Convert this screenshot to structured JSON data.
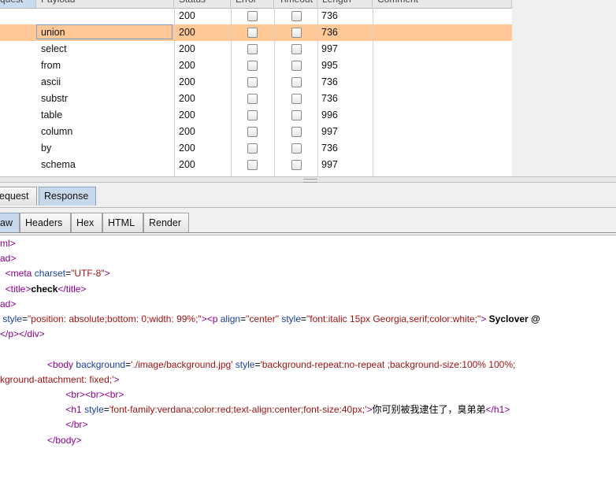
{
  "table": {
    "headers": [
      {
        "id": "request",
        "label": "quest"
      },
      {
        "id": "payload",
        "label": "Payload"
      },
      {
        "id": "status",
        "label": "Status"
      },
      {
        "id": "error",
        "label": "Error"
      },
      {
        "id": "timeout",
        "label": "Timeout"
      },
      {
        "id": "length",
        "label": "Length"
      },
      {
        "id": "comment",
        "label": "Comment"
      }
    ],
    "rows": [
      {
        "payload": "",
        "status": "200",
        "error": false,
        "timeout": false,
        "length": "736",
        "selected": false
      },
      {
        "payload": "union",
        "status": "200",
        "error": false,
        "timeout": false,
        "length": "736",
        "selected": true
      },
      {
        "payload": "select",
        "status": "200",
        "error": false,
        "timeout": false,
        "length": "997",
        "selected": false
      },
      {
        "payload": "from",
        "status": "200",
        "error": false,
        "timeout": false,
        "length": "995",
        "selected": false
      },
      {
        "payload": "ascii",
        "status": "200",
        "error": false,
        "timeout": false,
        "length": "736",
        "selected": false
      },
      {
        "payload": "substr",
        "status": "200",
        "error": false,
        "timeout": false,
        "length": "736",
        "selected": false
      },
      {
        "payload": "table",
        "status": "200",
        "error": false,
        "timeout": false,
        "length": "996",
        "selected": false
      },
      {
        "payload": "column",
        "status": "200",
        "error": false,
        "timeout": false,
        "length": "997",
        "selected": false
      },
      {
        "payload": "by",
        "status": "200",
        "error": false,
        "timeout": false,
        "length": "736",
        "selected": false
      },
      {
        "payload": "schema",
        "status": "200",
        "error": false,
        "timeout": false,
        "length": "997",
        "selected": false
      }
    ]
  },
  "tabs": {
    "main": [
      {
        "label": "equest",
        "active": false
      },
      {
        "label": "Response",
        "active": true
      }
    ],
    "sub": [
      {
        "label": "aw",
        "active": true
      },
      {
        "label": "Headers",
        "active": false
      },
      {
        "label": "Hex",
        "active": false
      },
      {
        "label": "HTML",
        "active": false
      },
      {
        "label": "Render",
        "active": false
      }
    ]
  },
  "code": {
    "lines": [
      [
        {
          "t": "tag",
          "v": "ml>"
        }
      ],
      [
        {
          "t": "tag",
          "v": "ad>"
        }
      ],
      [
        {
          "t": "txt",
          "v": "  "
        },
        {
          "t": "tag",
          "v": "<meta "
        },
        {
          "t": "attr",
          "v": "charset"
        },
        {
          "t": "txt",
          "v": "="
        },
        {
          "t": "val",
          "v": "\"UTF-8\""
        },
        {
          "t": "tag",
          "v": ">"
        }
      ],
      [
        {
          "t": "txt",
          "v": "  "
        },
        {
          "t": "tag",
          "v": "<title>"
        },
        {
          "t": "bold",
          "v": "check"
        },
        {
          "t": "tag",
          "v": "</title>"
        }
      ],
      [
        {
          "t": "tag",
          "v": "ad>"
        }
      ],
      [
        {
          "t": "txt",
          "v": " "
        },
        {
          "t": "attr",
          "v": "style"
        },
        {
          "t": "txt",
          "v": "="
        },
        {
          "t": "val",
          "v": "\"position: absolute;bottom: 0;width: 99%;\""
        },
        {
          "t": "tag",
          "v": "><p "
        },
        {
          "t": "attr",
          "v": "align"
        },
        {
          "t": "txt",
          "v": "="
        },
        {
          "t": "val",
          "v": "\"center\" "
        },
        {
          "t": "attr",
          "v": "style"
        },
        {
          "t": "txt",
          "v": "="
        },
        {
          "t": "val",
          "v": "\"font:italic 15px Georgia,serif;color:white;\""
        },
        {
          "t": "tag",
          "v": ">"
        },
        {
          "t": "bold",
          "v": " Syclover @"
        }
      ],
      [
        {
          "t": "tag",
          "v": "</p></div>"
        }
      ],
      [
        {
          "t": "txt",
          "v": ""
        }
      ],
      [
        {
          "t": "txt",
          "v": "                  "
        },
        {
          "t": "tag",
          "v": "<body "
        },
        {
          "t": "attr",
          "v": "background"
        },
        {
          "t": "txt",
          "v": "="
        },
        {
          "t": "val",
          "v": "'./image/background.jpg' "
        },
        {
          "t": "attr",
          "v": "style"
        },
        {
          "t": "txt",
          "v": "="
        },
        {
          "t": "val",
          "v": "'background-repeat:no-repeat ;background-size:100% 100%;"
        }
      ],
      [
        {
          "t": "val",
          "v": "kground-attachment: fixed;'"
        },
        {
          "t": "tag",
          "v": ">"
        }
      ],
      [
        {
          "t": "txt",
          "v": "                         "
        },
        {
          "t": "tag",
          "v": "<br><br><br>"
        }
      ],
      [
        {
          "t": "txt",
          "v": "                         "
        },
        {
          "t": "tag",
          "v": "<h1 "
        },
        {
          "t": "attr",
          "v": "style"
        },
        {
          "t": "txt",
          "v": "="
        },
        {
          "t": "val",
          "v": "'font-family:verdana;color:red;text-align:center;font-size:40px;'"
        },
        {
          "t": "tag",
          "v": ">"
        },
        {
          "t": "txt",
          "v": "你可别被我逮住了，臭弟弟"
        },
        {
          "t": "tag",
          "v": "</h1>"
        }
      ],
      [
        {
          "t": "txt",
          "v": "                         "
        },
        {
          "t": "tag",
          "v": "</br>"
        }
      ],
      [
        {
          "t": "txt",
          "v": "                  "
        },
        {
          "t": "tag",
          "v": "</body>"
        }
      ]
    ]
  }
}
